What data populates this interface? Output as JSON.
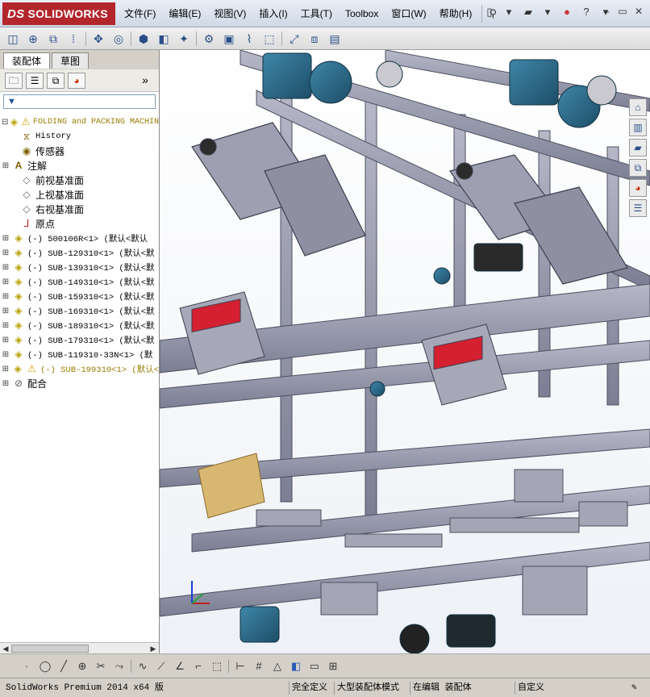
{
  "app": {
    "logo_prefix": "DS",
    "logo_text": "SOLIDWORKS"
  },
  "menu": [
    "文件(F)",
    "编辑(E)",
    "视图(V)",
    "插入(I)",
    "工具(T)",
    "Toolbox",
    "窗口(W)",
    "帮助(H)"
  ],
  "left_panel": {
    "tabs": [
      "装配体",
      "草图"
    ],
    "tree": {
      "root": "FOLDING and PACKING MACHIN",
      "history": "History",
      "sensors": "传感器",
      "annotations": "注解",
      "front_plane": "前视基准面",
      "top_plane": "上视基准面",
      "right_plane": "右视基准面",
      "origin": "原点",
      "components": [
        "(-) 500106R<1> (默认<默认",
        "(-) SUB-129310<1> (默认<默",
        "(-) SUB-139310<1> (默认<默",
        "(-) SUB-149310<1> (默认<默",
        "(-) SUB-159310<1> (默认<默",
        "(-) SUB-169310<1> (默认<默",
        "(-) SUB-189310<1> (默认<默",
        "(-) SUB-179310<1> (默认<默",
        "(-) SUB-119310-33N<1> (默",
        "(-) SUB-199310<1> (默认<"
      ],
      "mates": "配合"
    }
  },
  "status_bar": {
    "product": "SolidWorks Premium 2014 x64 版",
    "definition": "完全定义",
    "mode": "大型装配体模式",
    "editing": "在编辑 装配体",
    "custom": "自定义"
  },
  "colors": {
    "logo": "#b3262c",
    "frame": "#8c8fa3",
    "motor": "#2d6a8a",
    "gripper": "#d42030",
    "panel": "#8a8aa0"
  }
}
